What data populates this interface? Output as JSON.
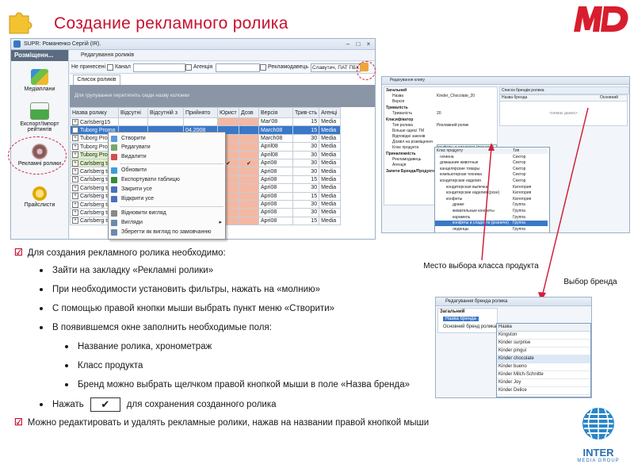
{
  "slide": {
    "title": "Создание рекламного ролика",
    "brand_color": "#c8102e",
    "logo_icon": "md-logo",
    "puzzle_icon": "puzzle-icon",
    "footer_logo": {
      "name": "INTER",
      "sub": "MEDIA GROUP"
    }
  },
  "app": {
    "window_title": "SUPR: Романенко Сергій (IR).",
    "sidebar": {
      "header": "Розміщенн...",
      "items": [
        {
          "label": "Медіаплани",
          "icon": "mediaplan-icon"
        },
        {
          "label": "Експорт/Імпорт рейтингів",
          "icon": "chart-icon"
        },
        {
          "label": "Рекламні ролики",
          "icon": "film-reel-icon"
        },
        {
          "label": "Прайслисти",
          "icon": "price-icon"
        }
      ]
    },
    "panel_title": "Редагування роликів",
    "filters": {
      "not_assigned": "Не принесені",
      "channel": "Канал",
      "agency": "Агенція",
      "advertiser_label": "Рекламодавець",
      "advertiser_value": "Славутич, ПАТ ПБК"
    },
    "tab": "Список роликів",
    "grouping_hint": "Для групування перетягніть сюди назву колонки",
    "columns": [
      "Назва ролику",
      "Відсутні",
      "Відсутній з",
      "Прийнято",
      "Юрист",
      "Дозв",
      "Версія",
      "Трив-сть",
      "Агенці"
    ],
    "rows": [
      {
        "name": "Carlsberg15",
        "date": "",
        "ur": "",
        "dz": "",
        "ver": "Mar'08",
        "dur": "15",
        "ag": "Media"
      },
      {
        "name": "Tuborg Promo",
        "date": "04.2008",
        "ur": "",
        "dz": "",
        "ver": "March08",
        "dur": "15",
        "ag": "Media"
      },
      {
        "name": "Tuborg Promo",
        "date": "04.2008",
        "ur": "",
        "dz": "",
        "ver": "March08",
        "dur": "30",
        "ag": "Media"
      },
      {
        "name": "Tuborg Promo",
        "date": "04.2008",
        "ur": "",
        "dz": "",
        "ver": "April08",
        "dur": "30",
        "ag": "Media"
      },
      {
        "name": "Tuborg Promo",
        "date": "04.2008",
        "ur": "",
        "dz": "",
        "ver": "April08",
        "dur": "30",
        "ag": "Media"
      },
      {
        "name": "Carlsberg tick",
        "date": "04.2008",
        "ur": "✔",
        "dz": "✔",
        "ver": "Apri08",
        "dur": "30",
        "ag": "Media"
      },
      {
        "name": "Carlsberg tick",
        "date": "04.2008",
        "ur": "",
        "dz": "",
        "ver": "Apri08",
        "dur": "30",
        "ag": "Media"
      },
      {
        "name": "Carlsberg tick",
        "date": "04.2008",
        "ur": "",
        "dz": "",
        "ver": "Apri08",
        "dur": "15",
        "ag": "Media"
      },
      {
        "name": "Carlsberg tick",
        "date": "04.2008",
        "ur": "",
        "dz": "",
        "ver": "Apri08",
        "dur": "30",
        "ag": "Media"
      },
      {
        "name": "Carlsberg tick",
        "date": "04.2008",
        "ur": "",
        "dz": "",
        "ver": "Apri08",
        "dur": "15",
        "ag": "Media"
      },
      {
        "name": "Carlsberg tick",
        "date": "04.2008",
        "ur": "",
        "dz": "",
        "ver": "Apri08",
        "dur": "30",
        "ag": "Media"
      },
      {
        "name": "Carlsberg tick",
        "date": "04.2008",
        "ur": "",
        "dz": "",
        "ver": "Apri08",
        "dur": "30",
        "ag": "Media"
      },
      {
        "name": "Carlsberg tick",
        "date": "04.2008",
        "ur": "",
        "dz": "",
        "ver": "Apri08",
        "dur": "15",
        "ag": "Media"
      }
    ],
    "context_menu": [
      {
        "label": "Створити",
        "icon": "create-icon"
      },
      {
        "label": "Редагувати",
        "icon": "edit-icon"
      },
      {
        "label": "Видалити",
        "icon": "delete-icon"
      },
      {
        "label": "Обновити",
        "icon": "refresh-icon"
      },
      {
        "label": "Експортувати таблицю",
        "icon": "export-icon"
      },
      {
        "label": "Закрити усе",
        "icon": "collapse-icon"
      },
      {
        "label": "Відкрити усе",
        "icon": "expand-icon"
      },
      {
        "label": "Відновити вигляд",
        "icon": "restore-view-icon"
      },
      {
        "label": "Вигляди",
        "icon": "views-icon"
      },
      {
        "label": "Зберегти як вигляд по замовчанню",
        "icon": "save-view-icon"
      }
    ]
  },
  "win2": {
    "title": "Редагування клипу",
    "group1": "Загальний",
    "f_name": "Назва",
    "f_name_val": "Kinder_Chocolate_20",
    "f_version": "Версія",
    "group2": "Тривалість",
    "f_duration": "Тривалість",
    "f_duration_val": "20",
    "group3": "Класифікатор",
    "f_type": "Тип ролика",
    "f_type_val": "Рекламний ролик",
    "f_tm": "Більше однієї ТМ",
    "f_adult": "Відповідні законів",
    "f_share": "Дозвіл на розміщення",
    "f_class": "Клас продукта",
    "f_class_val": "конфеты и сладости (розничн)",
    "group4": "Приналежність",
    "f_advertiser": "Рекламодавець",
    "f_agency": "Агенція",
    "group5": "Запити Бренда/Продукта",
    "brand_tab": "Список брендів ролика",
    "brand_cols": [
      "Назва бренда",
      "Основний"
    ],
    "brand_hint": "<немає даних>",
    "tree": [
      [
        "Клас продукту",
        "Тип"
      ],
      [
        "гигиена",
        "Сектор"
      ],
      [
        "домашние животные",
        "Сектор"
      ],
      [
        "канцелярские товары",
        "Сектор"
      ],
      [
        "компьютерная техника",
        "Сектор"
      ],
      [
        "кондитерские изделия",
        "Сектор"
      ],
      [
        "кондитерская выпечка",
        "Категория"
      ],
      [
        "кондитерские изделия (розн)",
        "Категория"
      ],
      [
        "конфеты",
        "Категория"
      ],
      [
        "драже",
        "Группа"
      ],
      [
        "жевательные конфеты",
        "Группа"
      ],
      [
        "карамель",
        "Группа"
      ],
      [
        "конфеты и сладости (розничн)",
        "Группа"
      ],
      [
        "леденцы",
        "Группа"
      ],
      [
        "мармелад",
        "Группа"
      ]
    ]
  },
  "notes": {
    "class_place": "Место выбора класса продукта",
    "brand_choice": "Выбор бренда"
  },
  "win3": {
    "title": "Редагування бренда ролика",
    "group": "Загальний",
    "f_brand": "Назва бренда",
    "f_main": "Основний бренд ролика",
    "list_header": "Назва",
    "brands": [
      "Kingston",
      "Kinder surprise",
      "Kinder pingui",
      "Kinder chocolate",
      "Kinder bueno",
      "Kinder Milch-Schnitte",
      "Kinder Joy",
      "Kinder Delice"
    ]
  },
  "bullets": {
    "b1": "Для создания рекламного ролика необходимо:",
    "s1": "Зайти на закладку «Рекламні ролики»",
    "s2": "При необходимости установить фильтры, нажать на «молнию»",
    "s3": "С помощью правой кнопки мыши выбрать пункт меню «Створити»",
    "s4": "В появившемся окне заполнить необходимые поля:",
    "ss1": "Название ролика, хронометраж",
    "ss2": "Класс продукта",
    "ss3": "Бренд можно выбрать щелчком правой кнопкой мыши в поле «Назва бренда»",
    "s5a": "Нажать",
    "s5_btn": "✔",
    "s5b": "для сохранения созданного ролика",
    "b2": "Можно редактировать и удалять рекламные ролики, нажав на названии правой кнопкой мыши"
  }
}
